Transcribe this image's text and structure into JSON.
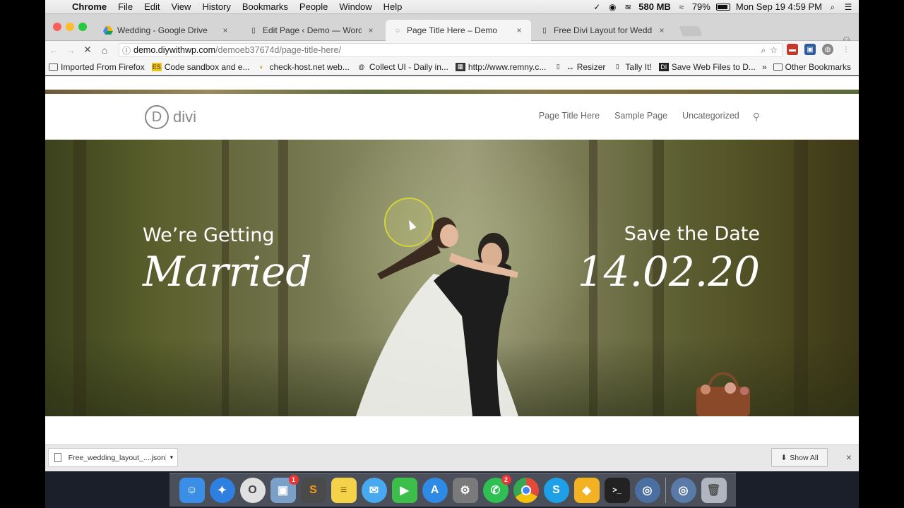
{
  "menubar": {
    "app": "Chrome",
    "items": [
      "File",
      "Edit",
      "View",
      "History",
      "Bookmarks",
      "People",
      "Window",
      "Help"
    ],
    "memory": "580 MB",
    "battery": "79%",
    "battery_level": 0.79,
    "datetime": "Mon Sep 19  4:59 PM"
  },
  "tabs": [
    {
      "title": "Wedding - Google Drive",
      "icon": "google-drive-icon"
    },
    {
      "title": "Edit Page ‹ Demo — WordPres",
      "icon": "page-icon"
    },
    {
      "title": "Page Title Here – Demo",
      "icon": "loading-spinner-icon"
    },
    {
      "title": "Free Divi Layout for Wedding |",
      "icon": "page-icon"
    }
  ],
  "toolbar": {
    "url_host": "demo.diywithwp.com",
    "url_path": "/demoeb37674d/page-title-here/"
  },
  "bookmarks": {
    "items": [
      "Imported From Firefox",
      "Code sandbox and e...",
      "check-host.net web...",
      "Collect UI - Daily in...",
      "http://www.remny.c...",
      "↔ Resizer",
      "Tally It!",
      "Save Web Files to D..."
    ],
    "other": "Other Bookmarks",
    "overflow": "»"
  },
  "site": {
    "logo_letter": "D",
    "logo_word": "divi",
    "nav": [
      "Page Title Here",
      "Sample Page",
      "Uncategorized"
    ]
  },
  "hero": {
    "left_small": "We’re Getting",
    "left_big": "Married",
    "right_small": "Save the Date",
    "right_big": "14.02.20"
  },
  "downloads": {
    "file": "Free_wedding_layout_....json",
    "show_all": "Show All"
  },
  "dock": {
    "apps": [
      {
        "name": "finder-icon",
        "color": "#3a8ee6"
      },
      {
        "name": "safari-icon",
        "color": "#2f7fe0"
      },
      {
        "name": "opera-icon",
        "color": "#666666"
      },
      {
        "name": "preview-icon",
        "color": "#7aa0c8"
      },
      {
        "name": "sublime-text-icon",
        "color": "#4a4a4a"
      },
      {
        "name": "notes-icon",
        "color": "#f4d34a"
      },
      {
        "name": "messages-icon",
        "color": "#48a9f0"
      },
      {
        "name": "facetime-icon",
        "color": "#3bbf4a"
      },
      {
        "name": "app-store-icon",
        "color": "#2f8ae6"
      },
      {
        "name": "system-preferences-icon",
        "color": "#7a7a7a"
      },
      {
        "name": "whatsapp-icon",
        "color": "#2fbf52"
      },
      {
        "name": "chrome-icon",
        "color": "#e44a3a"
      },
      {
        "name": "skype-icon",
        "color": "#1fa0e6"
      },
      {
        "name": "sketch-icon",
        "color": "#f2b221"
      },
      {
        "name": "terminal-icon",
        "color": "#222222"
      },
      {
        "name": "alfred-icon",
        "color": "#4a6fa0"
      }
    ],
    "badges": {
      "preview": "1",
      "whatsapp": "2"
    },
    "trash": "trash-icon"
  }
}
